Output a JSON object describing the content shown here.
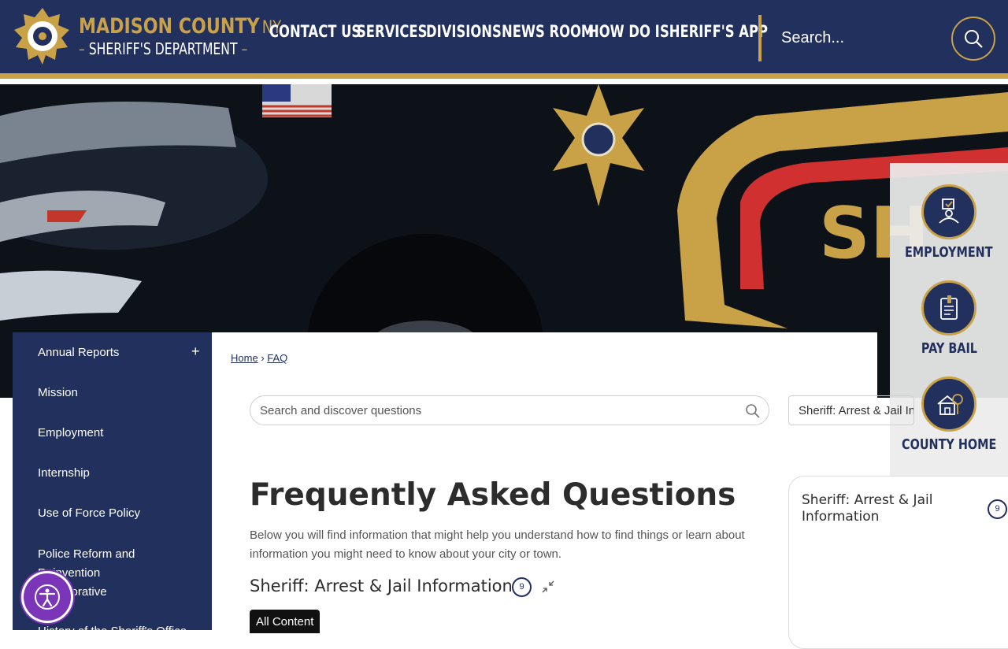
{
  "header": {
    "logo_title": "MADISON COUNTY",
    "logo_state": "NY",
    "logo_subtitle": "SHERIFF'S DEPARTMENT",
    "nav": [
      "CONTACT US",
      "SERVICES",
      "DIVISIONS",
      "NEWS ROOM",
      "HOW DO I",
      "SHERIFF'S APP"
    ],
    "search_placeholder": "Search..."
  },
  "quick_links": [
    {
      "label": "EMPLOYMENT",
      "icon": "employment-icon"
    },
    {
      "label": "PAY BAIL",
      "icon": "pay-bail-icon"
    },
    {
      "label": "COUNTY HOME",
      "icon": "county-home-icon"
    }
  ],
  "sidebar": {
    "items": [
      {
        "label": "Annual Reports",
        "expand": "+"
      },
      {
        "label": "Mission"
      },
      {
        "label": "Employment"
      },
      {
        "label": "Internship"
      },
      {
        "label": "Use of Force Policy"
      },
      {
        "label": "Police Reform and Reinvention Collaborative"
      },
      {
        "label": "History of the Sheriff's Office"
      }
    ]
  },
  "breadcrumb": {
    "home": "Home",
    "sep": "›",
    "current": "FAQ"
  },
  "faq": {
    "search_placeholder": "Search and discover questions",
    "category_select": "Sheriff: Arrest & Jail Information",
    "title": "Frequently Asked Questions",
    "intro": "Below you will find information that might help you understand how to find things or learn about information you might need to know about your city or town.",
    "section_title": "Sheriff: Arrest & Jail Information",
    "section_count": "9",
    "tab_all": "All Content"
  },
  "side_card": {
    "title": "Sheriff: Arrest & Jail Information",
    "count": "9"
  },
  "colors": {
    "navy": "#22305e",
    "gold": "#c9a248",
    "accessibility": "#7a35b8"
  }
}
